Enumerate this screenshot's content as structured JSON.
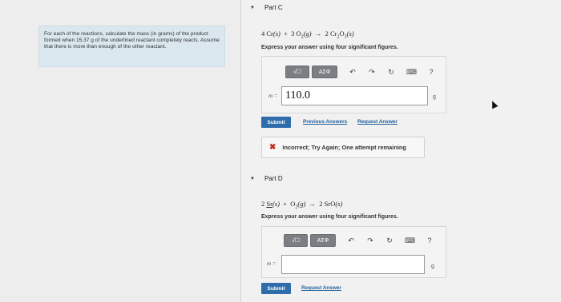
{
  "instructions": "For each of the reactions, calculate the mass (in grams) of the product formed when 15.37 g of the underlined reactant completely reacts. Assume that there is more than enough of the other reactant.",
  "part_c": {
    "header": "Part C",
    "reaction": {
      "c1": "4",
      "s1": "Cr",
      "p1": "(s)",
      "plus": "+",
      "c2": "3",
      "s2": "O",
      "sub2": "2",
      "p2": "(g)",
      "arrow": "→",
      "c3": "2",
      "s3": "Cr",
      "sub3a": "2",
      "s3b": "O",
      "sub3b": "3",
      "p3": "(s)"
    },
    "prompt": "Express your answer using four significant figures.",
    "toolbar": {
      "templates": "√☐",
      "symbols": "ΑΣΦ",
      "undo": "↶",
      "redo": "↷",
      "reset": "↻",
      "keyboard": "⌨",
      "help": "?"
    },
    "variable": "m =",
    "value": "110.0",
    "unit": "g",
    "submit": "Submit",
    "previous_answers": "Previous Answers",
    "request_answer": "Request Answer",
    "feedback": "Incorrect; Try Again; One attempt remaining",
    "feedback_icon": "✖"
  },
  "part_d": {
    "header": "Part D",
    "reaction": {
      "c1": "2",
      "s1": "Sr",
      "p1": "(s)",
      "plus": "+",
      "s2": "O",
      "sub2": "2",
      "p2": "(g)",
      "arrow": "→",
      "c3": "2",
      "s3": "SrO",
      "p3": "(s)"
    },
    "prompt": "Express your answer using four significant figures.",
    "toolbar": {
      "templates": "√☐",
      "symbols": "ΑΣΦ",
      "undo": "↶",
      "redo": "↷",
      "reset": "↻",
      "keyboard": "⌨",
      "help": "?"
    },
    "variable": "m =",
    "value": "",
    "unit": "g",
    "submit": "Submit",
    "request_answer": "Request Answer"
  },
  "colors": {
    "accent": "#2f6cac",
    "link": "#1f5f9b",
    "error": "#c62a1f",
    "toolbar": "#7b7f84"
  },
  "caret_icon": "▼"
}
